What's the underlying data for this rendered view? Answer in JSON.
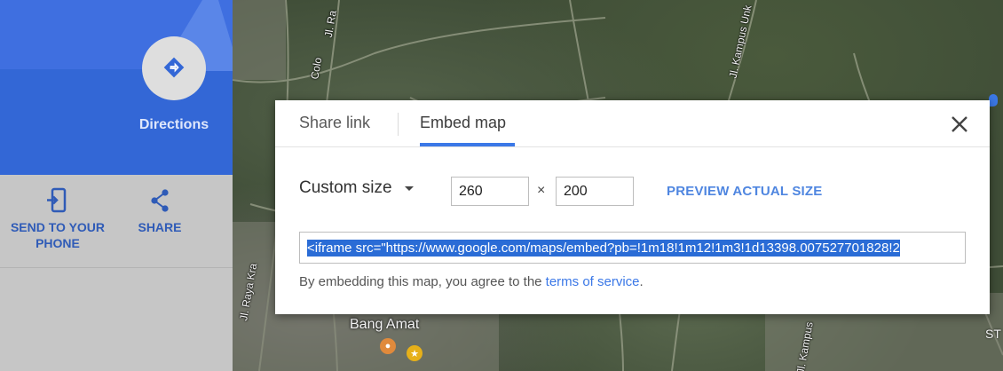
{
  "left_panel": {
    "directions_label": "Directions",
    "actions": [
      {
        "label_line1": "SEND TO YOUR",
        "label_line2": "PHONE",
        "icon": "send-to-phone-icon"
      },
      {
        "label": "SHARE",
        "icon": "share-icon"
      }
    ],
    "colors": {
      "hero": "#3367d6",
      "action_text": "#2f5bb7"
    }
  },
  "map": {
    "road_labels": [
      "Jl. Ra",
      "Colo",
      "Jl. Kampus Unk",
      "Jl. Raya Kra",
      "Jl. Kampus"
    ],
    "place_label": "Bang Amat",
    "edge_label": "ST"
  },
  "dialog": {
    "tabs": [
      {
        "label": "Share link",
        "active": false
      },
      {
        "label": "Embed map",
        "active": true
      }
    ],
    "size_select": {
      "value": "Custom size"
    },
    "width_value": "260",
    "times_symbol": "×",
    "height_value": "200",
    "preview_label": "PREVIEW ACTUAL SIZE",
    "embed_code": "<iframe src=\"https://www.google.com/maps/embed?pb=!1m18!1m12!1m3!1d13398.007527701828!2",
    "agree_prefix": "By embedding this map, you agree to the ",
    "terms_link": "terms of service",
    "agree_suffix": ".",
    "colors": {
      "accent": "#3b78e7",
      "selection": "#2a6cd6"
    }
  }
}
